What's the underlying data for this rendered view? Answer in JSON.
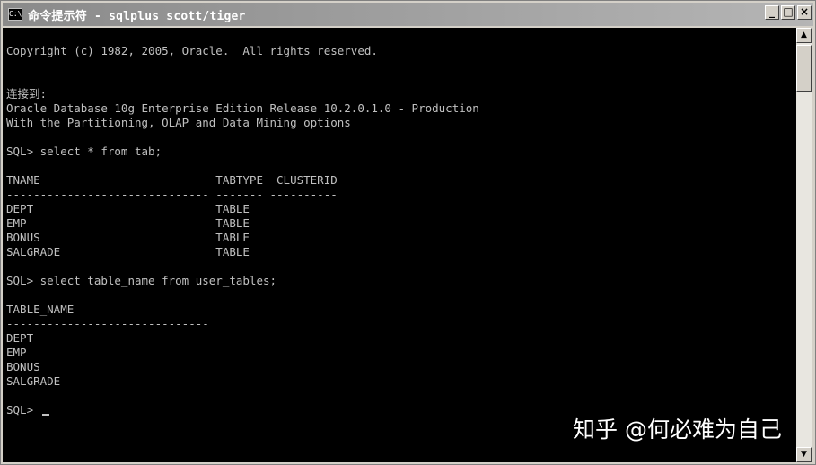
{
  "window": {
    "title": "命令提示符 - sqlplus scott/tiger",
    "icon": "cmd-icon",
    "buttons": {
      "minimize": "_",
      "maximize": "□",
      "close": "×"
    }
  },
  "console": {
    "lines": [
      "Copyright (c) 1982, 2005, Oracle.  All rights reserved.",
      "连接到:",
      "Oracle Database 10g Enterprise Edition Release 10.2.0.1.0 - Production",
      "With the Partitioning, OLAP and Data Mining options",
      "SQL> select * from tab;",
      "TNAME                          TABTYPE  CLUSTERID",
      "------------------------------ ------- ----------",
      "DEPT                           TABLE",
      "EMP                            TABLE",
      "BONUS                          TABLE",
      "SALGRADE                       TABLE",
      "SQL> select table_name from user_tables;",
      "TABLE_NAME",
      "------------------------------",
      "DEPT",
      "EMP",
      "BONUS",
      "SALGRADE",
      "SQL> "
    ]
  },
  "scrollbar": {
    "up_arrow": "▲",
    "down_arrow": "▼"
  },
  "watermark": "知乎 @何必难为自己",
  "colors": {
    "console_bg": "#000000",
    "console_fg": "#c0c0c0",
    "titlebar_inactive": "#a0a0a0"
  }
}
